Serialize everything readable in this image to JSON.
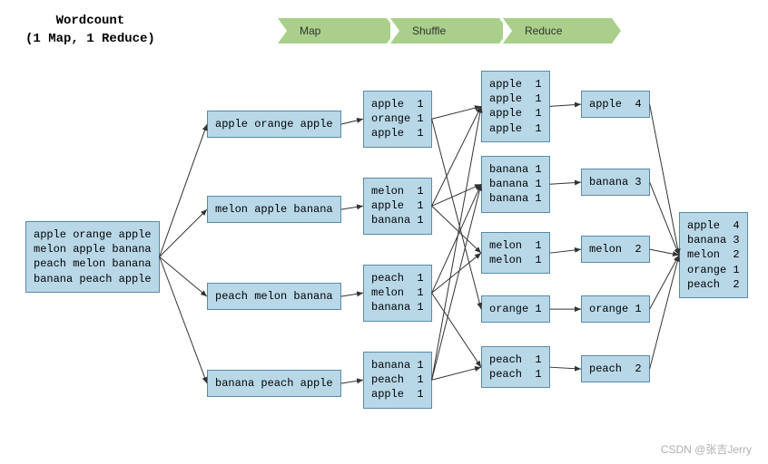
{
  "title": {
    "line1": "Wordcount",
    "line2": "(1 Map, 1 Reduce)"
  },
  "stages": [
    "Map",
    "Shuffle",
    "Reduce"
  ],
  "input": [
    "apple orange apple",
    "melon apple banana",
    "peach melon banana",
    "banana peach apple"
  ],
  "split": [
    "apple orange apple",
    "melon apple banana",
    "peach melon banana",
    "banana peach apple"
  ],
  "mapOut": [
    [
      "apple  1",
      "orange 1",
      "apple  1"
    ],
    [
      "melon  1",
      "apple  1",
      "banana 1"
    ],
    [
      "peach  1",
      "melon  1",
      "banana 1"
    ],
    [
      "banana 1",
      "peach  1",
      "apple  1"
    ]
  ],
  "shuffleOut": [
    [
      "apple  1",
      "apple  1",
      "apple  1",
      "apple  1"
    ],
    [
      "banana 1",
      "banana 1",
      "banana 1"
    ],
    [
      "melon  1",
      "melon  1"
    ],
    [
      "orange 1"
    ],
    [
      "peach  1",
      "peach  1"
    ]
  ],
  "reduceOut": [
    "apple  4",
    "banana 3",
    "melon  2",
    "orange 1",
    "peach  2"
  ],
  "final": [
    "apple  4",
    "banana 3",
    "melon  2",
    "orange 1",
    "peach  2"
  ],
  "watermark": "CSDN @张吉Jerry",
  "chart_data": {
    "type": "table",
    "title": "Wordcount MapReduce flow",
    "input_lines": [
      "apple orange apple",
      "melon apple banana",
      "peach melon banana",
      "banana peach apple"
    ],
    "map_output": [
      {
        "word": "apple",
        "count": 1
      },
      {
        "word": "orange",
        "count": 1
      },
      {
        "word": "apple",
        "count": 1
      },
      {
        "word": "melon",
        "count": 1
      },
      {
        "word": "apple",
        "count": 1
      },
      {
        "word": "banana",
        "count": 1
      },
      {
        "word": "peach",
        "count": 1
      },
      {
        "word": "melon",
        "count": 1
      },
      {
        "word": "banana",
        "count": 1
      },
      {
        "word": "banana",
        "count": 1
      },
      {
        "word": "peach",
        "count": 1
      },
      {
        "word": "apple",
        "count": 1
      }
    ],
    "shuffle_groups": {
      "apple": [
        1,
        1,
        1,
        1
      ],
      "banana": [
        1,
        1,
        1
      ],
      "melon": [
        1,
        1
      ],
      "orange": [
        1
      ],
      "peach": [
        1,
        1
      ]
    },
    "reduce_output": {
      "apple": 4,
      "banana": 3,
      "melon": 2,
      "orange": 1,
      "peach": 2
    }
  }
}
